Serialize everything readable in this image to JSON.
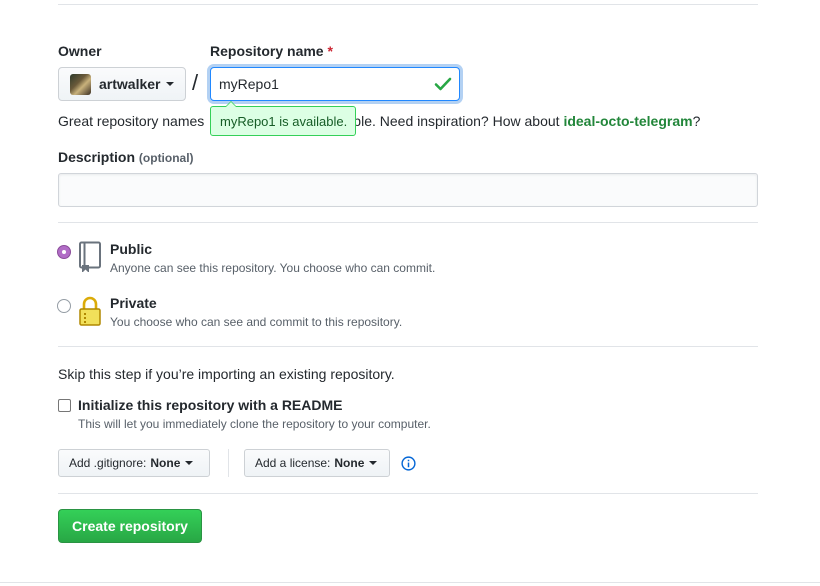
{
  "form": {
    "owner_label": "Owner",
    "repo_label": "Repository name",
    "required_mark": "*",
    "owner_name": "artwalker",
    "slash": "/",
    "repo_value": "myRepo1",
    "availability_tooltip": "myRepo1 is available.",
    "hint_prefix": "Great repository names",
    "hint_middle": "ble. Need inspiration? How about",
    "hint_suggestion": "ideal-octo-telegram",
    "hint_suffix": "?",
    "description_label": "Description",
    "description_optional": "(optional)",
    "description_value": ""
  },
  "visibility": {
    "public_title": "Public",
    "public_note": "Anyone can see this repository. You choose who can commit.",
    "public_selected": true,
    "private_title": "Private",
    "private_note": "You choose who can see and commit to this repository.",
    "private_selected": false
  },
  "init": {
    "skip_text": "Skip this step if you’re importing an existing repository.",
    "readme_label": "Initialize this repository with a README",
    "readme_note": "This will let you immediately clone the repository to your computer.",
    "readme_checked": false
  },
  "options": {
    "gitignore_label": "Add .gitignore:",
    "gitignore_value": "None",
    "license_label": "Add a license:",
    "license_value": "None"
  },
  "submit": {
    "create_label": "Create repository"
  },
  "colors": {
    "accent_green": "#28a745",
    "focus_blue": "#2188ff",
    "radio_purple": "#b16cc6",
    "info_blue": "#0366d6"
  },
  "icons": {
    "check": "check-icon",
    "public": "repo-book-icon",
    "private": "lock-icon",
    "info": "info-icon",
    "caret": "chevron-down-icon"
  }
}
